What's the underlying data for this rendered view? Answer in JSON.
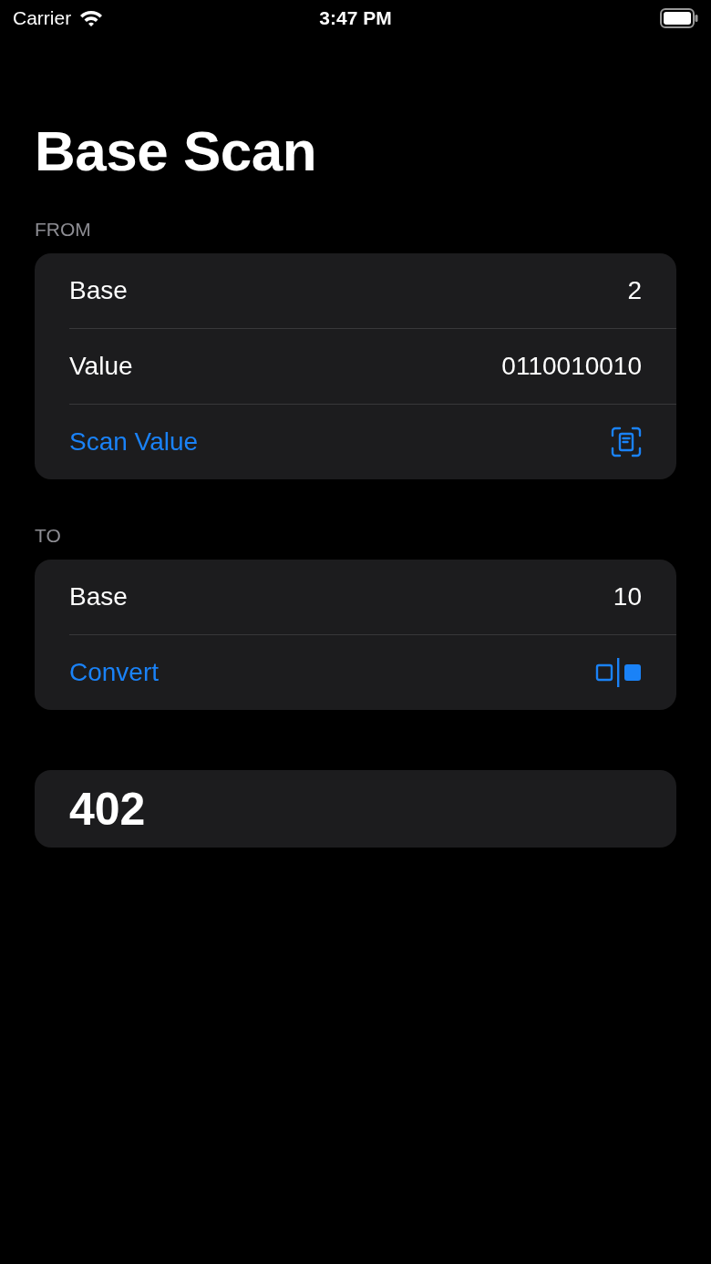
{
  "status_bar": {
    "carrier": "Carrier",
    "time": "3:47 PM"
  },
  "title": "Base Scan",
  "sections": [
    {
      "header": "FROM",
      "rows": [
        {
          "kind": "value",
          "label": "Base",
          "value": "2"
        },
        {
          "kind": "value",
          "label": "Value",
          "value": "0110010010"
        },
        {
          "kind": "scan",
          "label": "Scan Value"
        }
      ]
    },
    {
      "header": "TO",
      "rows": [
        {
          "kind": "value",
          "label": "Base",
          "value": "10"
        },
        {
          "kind": "convert",
          "label": "Convert"
        }
      ]
    }
  ],
  "result": "402"
}
